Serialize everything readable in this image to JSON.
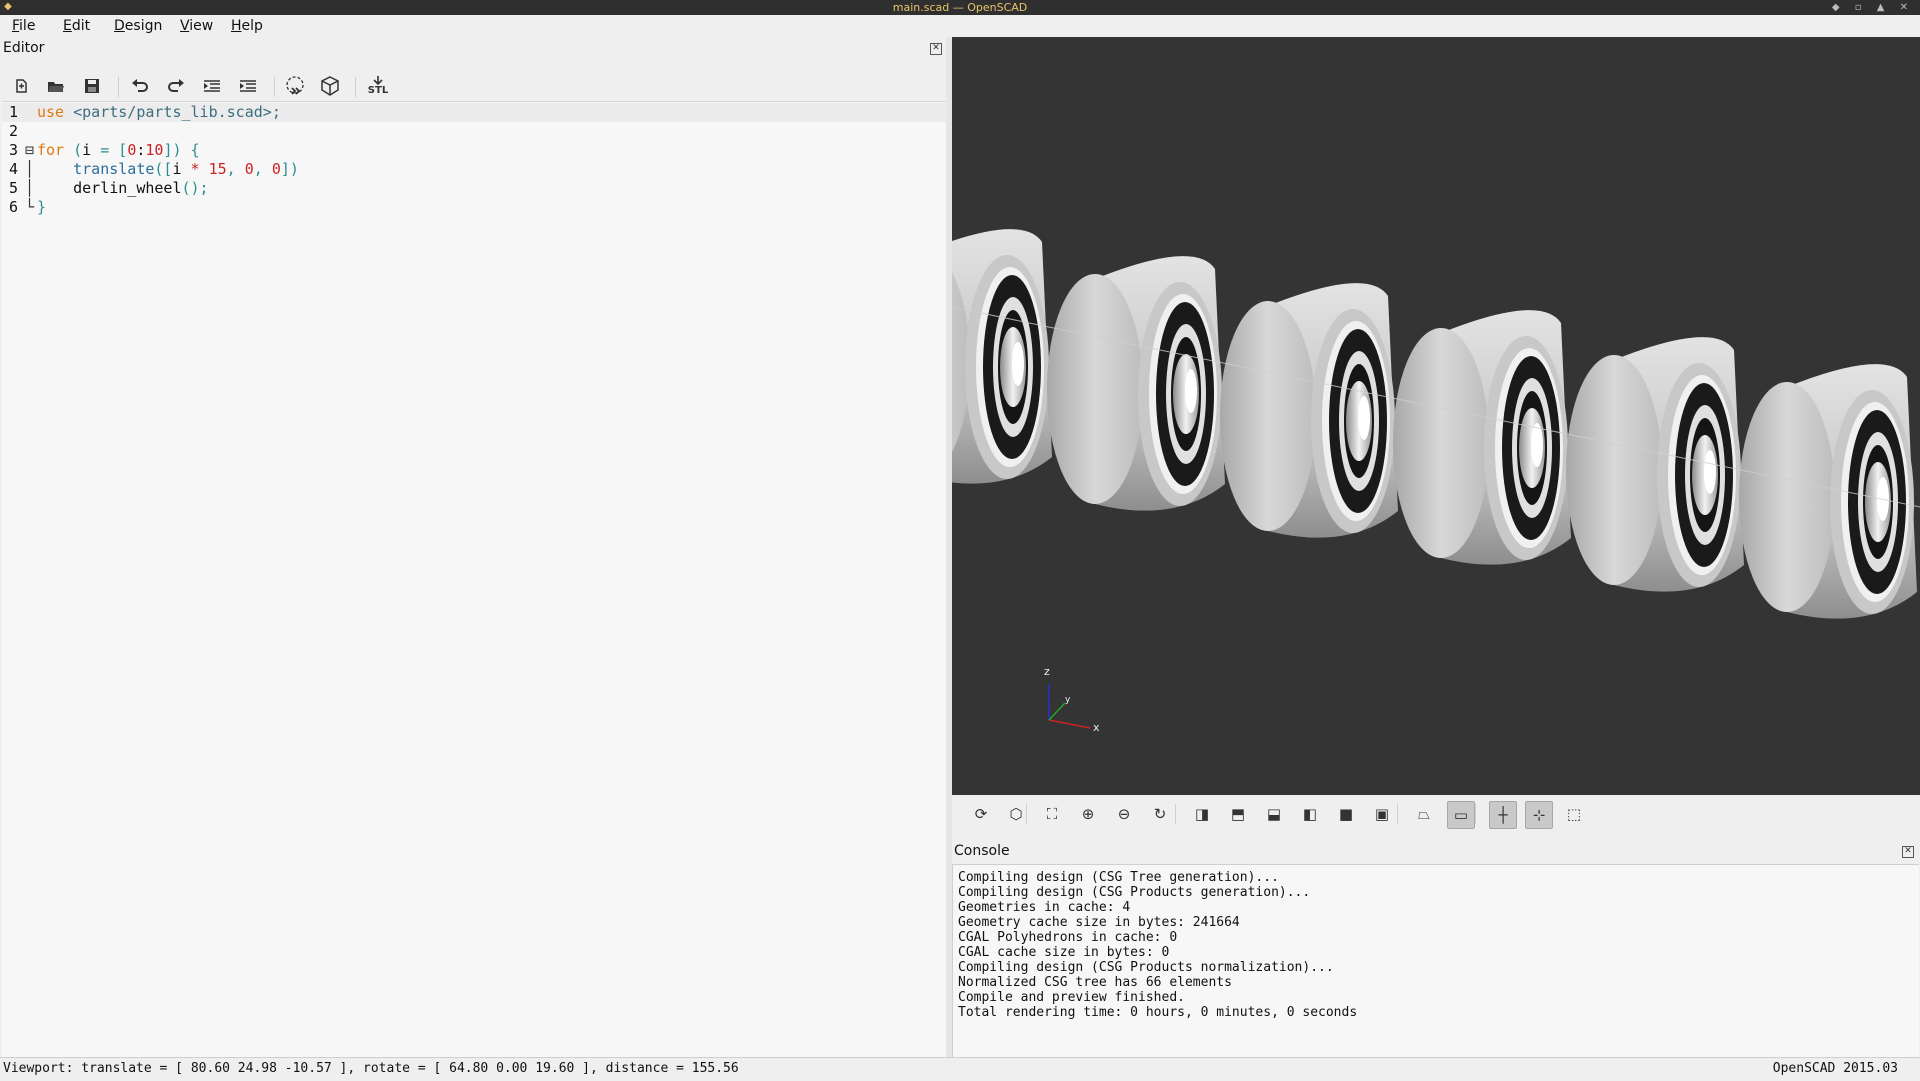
{
  "window": {
    "title": "main.scad — OpenSCAD"
  },
  "menu": [
    {
      "label": "File",
      "accel": "F",
      "rest": "ile"
    },
    {
      "label": "Edit",
      "accel": "E",
      "rest": "dit"
    },
    {
      "label": "Design",
      "accel": "D",
      "rest": "esign"
    },
    {
      "label": "View",
      "accel": "V",
      "rest": "iew"
    },
    {
      "label": "Help",
      "accel": "H",
      "rest": "elp"
    }
  ],
  "editor": {
    "title": "Editor",
    "toolbar": {
      "icons": [
        "new-file-icon",
        "open-file-icon",
        "save-icon",
        "undo-icon",
        "redo-icon",
        "unindent-icon",
        "indent-icon",
        "preview-icon",
        "render-icon",
        "export-stl-icon"
      ],
      "stl_label": "STL"
    },
    "lines": [
      {
        "num": "1",
        "tokens": [
          [
            "kw",
            "use"
          ],
          [
            "pl",
            " "
          ],
          [
            "str",
            "<parts/parts_lib.scad>"
          ],
          [
            "str",
            ";"
          ]
        ]
      },
      {
        "num": "2",
        "tokens": []
      },
      {
        "num": "3",
        "fold": "⊟",
        "tokens": [
          [
            "kw",
            "for"
          ],
          [
            "pl",
            " "
          ],
          [
            "brk",
            "("
          ],
          [
            "pl",
            "i "
          ],
          [
            "brk",
            "="
          ],
          [
            "pl",
            " "
          ],
          [
            "brk",
            "["
          ],
          [
            "num",
            "0"
          ],
          [
            "pl",
            ":"
          ],
          [
            "num",
            "10"
          ],
          [
            "brk",
            "]"
          ],
          [
            "brk",
            ")"
          ],
          [
            "pl",
            " "
          ],
          [
            "brk",
            "{"
          ]
        ]
      },
      {
        "num": "4",
        "fold": "│",
        "tokens": [
          [
            "pl",
            "    "
          ],
          [
            "id",
            "translate"
          ],
          [
            "brk",
            "(["
          ],
          [
            "pl",
            "i "
          ],
          [
            "op",
            "*"
          ],
          [
            "pl",
            " "
          ],
          [
            "num",
            "15"
          ],
          [
            "brk",
            ","
          ],
          [
            "pl",
            " "
          ],
          [
            "num",
            "0"
          ],
          [
            "brk",
            ","
          ],
          [
            "pl",
            " "
          ],
          [
            "num",
            "0"
          ],
          [
            "brk",
            "])"
          ]
        ]
      },
      {
        "num": "5",
        "fold": "│",
        "tokens": [
          [
            "pl",
            "    derlin_wheel"
          ],
          [
            "brk",
            "();"
          ]
        ]
      },
      {
        "num": "6",
        "fold": "└",
        "tokens": [
          [
            "brk",
            "}"
          ]
        ]
      }
    ]
  },
  "viewer": {
    "background": "#343434",
    "axes": {
      "z": "z",
      "y": "y",
      "x": "x"
    },
    "toolbar_icons": [
      "preview-icon",
      "render-icon",
      "view-all-icon",
      "zoom-in-icon",
      "zoom-out-icon",
      "reset-view-icon",
      "view-right-icon",
      "view-top-icon",
      "view-bottom-icon",
      "view-left-icon",
      "view-front-icon",
      "view-back-icon",
      "perspective-icon",
      "orthogonal-icon",
      "show-axes-icon",
      "show-scale-icon",
      "show-edges-icon"
    ]
  },
  "console": {
    "title": "Console",
    "lines": [
      "Compiling design (CSG Tree generation)...",
      "Compiling design (CSG Products generation)...",
      "Geometries in cache: 4",
      "Geometry cache size in bytes: 241664",
      "CGAL Polyhedrons in cache: 0",
      "CGAL cache size in bytes: 0",
      "Compiling design (CSG Products normalization)...",
      "Normalized CSG tree has 66 elements",
      "Compile and preview finished.",
      "Total rendering time: 0 hours, 0 minutes, 0 seconds"
    ]
  },
  "status": {
    "viewport": "Viewport: translate = [ 80.60 24.98 -10.57 ], rotate = [ 64.80 0.00 19.60 ], distance = 155.56",
    "version": "OpenSCAD 2015.03"
  }
}
